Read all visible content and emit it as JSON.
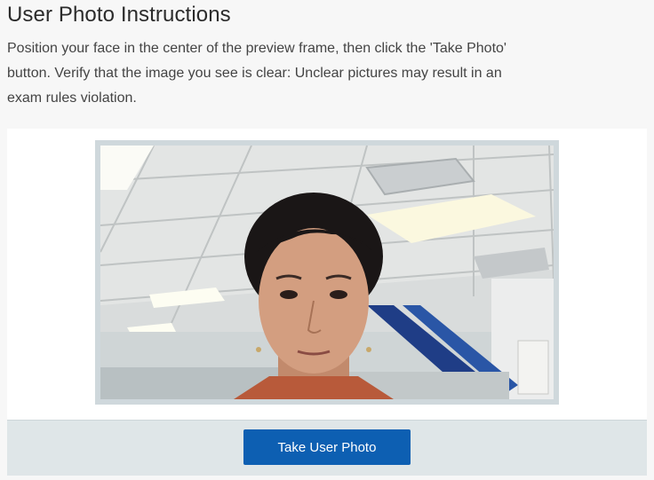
{
  "page": {
    "title": "User Photo Instructions",
    "instructions": "Position your face in the center of the preview frame, then click the 'Take Photo' button. Verify that the image you see is clear: Unclear pictures may result in an exam rules violation."
  },
  "actions": {
    "take_photo_label": "Take User Photo"
  },
  "colors": {
    "button": "#0d5fb2",
    "frame": "#cfd8dc",
    "action_bar": "#dfe6e8"
  }
}
